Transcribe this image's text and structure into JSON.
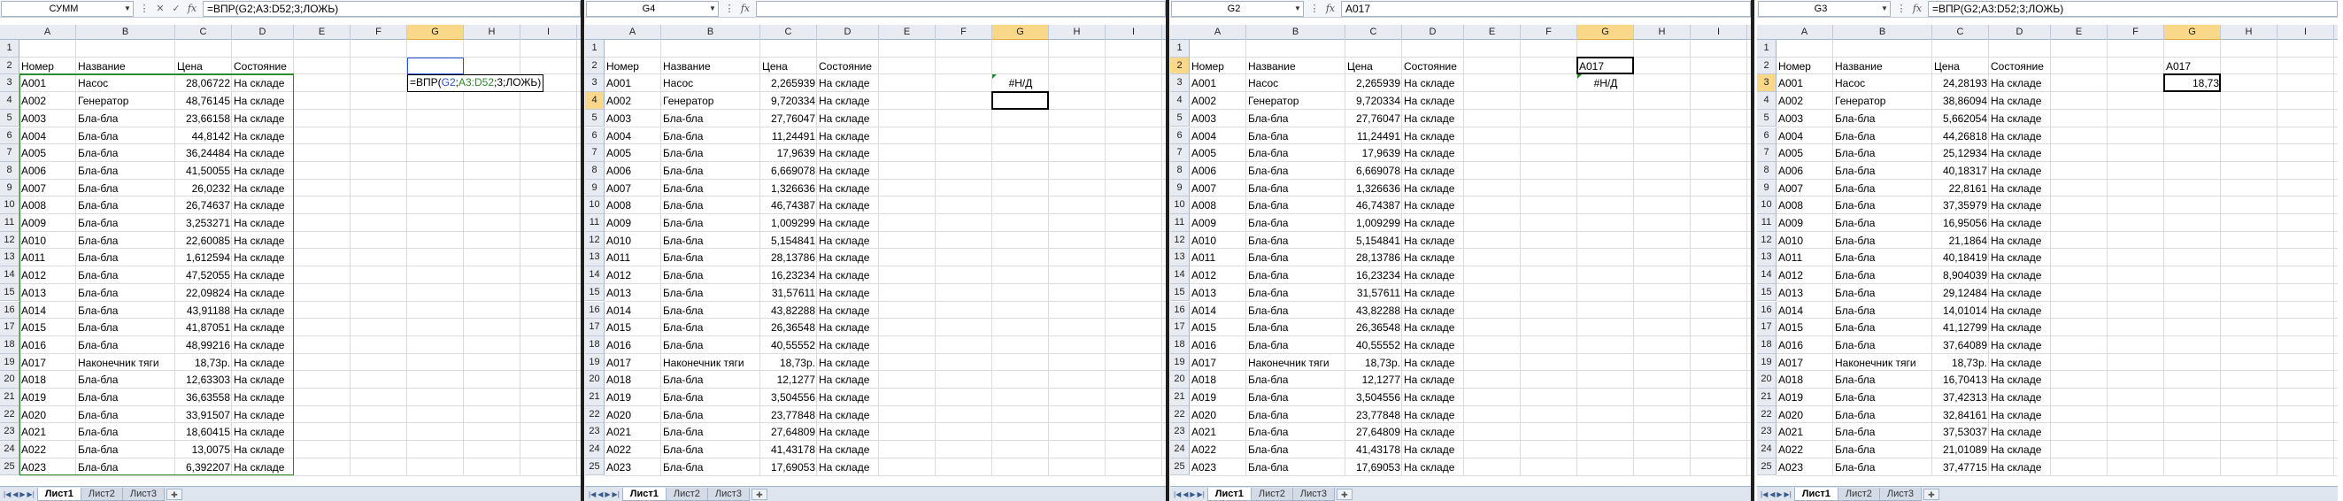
{
  "columns": [
    "A",
    "B",
    "C",
    "D",
    "E",
    "F",
    "G",
    "H",
    "I"
  ],
  "rows": [
    "1",
    "2",
    "3",
    "4",
    "5",
    "6",
    "7",
    "8",
    "9",
    "10",
    "11",
    "12",
    "13",
    "14",
    "15",
    "16",
    "17",
    "18",
    "19",
    "20",
    "21",
    "22",
    "23",
    "24",
    "25"
  ],
  "headers": {
    "A": "Номер",
    "B": "Название",
    "C": "Цена",
    "D": "Состояние"
  },
  "sheet_tabs": [
    "Лист1",
    "Лист2",
    "Лист3"
  ],
  "new_sheet_icon": "insert-sheet-icon",
  "fx_label": "fx",
  "panels": [
    {
      "namebox": "СУММ",
      "formula_parts": [
        {
          "t": "=ВПР(G2;A3:D52;3;ЛОЖЬ)",
          "c": ""
        }
      ],
      "selected_col": "G",
      "selected_row": "",
      "edit_formula_parts": [
        {
          "t": "=ВПР(",
          "c": ""
        },
        {
          "t": "G2",
          "c": "blue"
        },
        {
          "t": ";",
          "c": ""
        },
        {
          "t": "A3:D52",
          "c": "green"
        },
        {
          "t": ";3;ЛОЖЬ)",
          "c": ""
        }
      ],
      "g_cells": {},
      "ids": [
        "A001",
        "A002",
        "A003",
        "A004",
        "A005",
        "A006",
        "A007",
        "A008",
        "A009",
        "A010",
        "A011",
        "A012",
        "A013",
        "A014",
        "A015",
        "A016",
        "A017",
        "A018",
        "A019",
        "A020",
        "A021",
        "A022",
        "A023"
      ],
      "names": [
        "Насос",
        "Генератор",
        "Бла-бла",
        "Бла-бла",
        "Бла-бла",
        "Бла-бла",
        "Бла-бла",
        "Бла-бла",
        "Бла-бла",
        "Бла-бла",
        "Бла-бла",
        "Бла-бла",
        "Бла-бла",
        "Бла-бла",
        "Бла-бла",
        "Бла-бла",
        "Наконечник тяги",
        "Бла-бла",
        "Бла-бла",
        "Бла-бла",
        "Бла-бла",
        "Бла-бла",
        "Бла-бла"
      ],
      "prices": [
        "28,06722",
        "48,76145",
        "23,66158",
        "44,8142",
        "36,24484",
        "41,50055",
        "26,0232",
        "26,74637",
        "3,253271",
        "22,60085",
        "1,612594",
        "47,52055",
        "22,09824",
        "43,91188",
        "41,87051",
        "48,99216",
        "18,73р.",
        "12,63303",
        "36,63558",
        "33,91507",
        "18,60415",
        "13,0075",
        "6,392207"
      ],
      "statuses": [
        "На складе",
        "На складе",
        "На складе",
        "На складе",
        "На складе",
        "На складе",
        "На складе",
        "На складе",
        "На складе",
        "На складе",
        "На складе",
        "На складе",
        "На складе",
        "На складе",
        "На складе",
        "На складе",
        "На складе",
        "На складе",
        "На складе",
        "На складе",
        "На складе",
        "На складе",
        "На складе"
      ]
    },
    {
      "namebox": "G4",
      "formula_parts": [],
      "selected_col": "G",
      "selected_row": "4",
      "g_cells": {
        "3": "#Н/Д"
      },
      "ids": [
        "A001",
        "A002",
        "A003",
        "A004",
        "A005",
        "A006",
        "A007",
        "A008",
        "A009",
        "A010",
        "A011",
        "A012",
        "A013",
        "A014",
        "A015",
        "A016",
        "A017",
        "A018",
        "A019",
        "A020",
        "A021",
        "A022",
        "A023"
      ],
      "names": [
        "Насос",
        "Генератор",
        "Бла-бла",
        "Бла-бла",
        "Бла-бла",
        "Бла-бла",
        "Бла-бла",
        "Бла-бла",
        "Бла-бла",
        "Бла-бла",
        "Бла-бла",
        "Бла-бла",
        "Бла-бла",
        "Бла-бла",
        "Бла-бла",
        "Бла-бла",
        "Наконечник тяги",
        "Бла-бла",
        "Бла-бла",
        "Бла-бла",
        "Бла-бла",
        "Бла-бла",
        "Бла-бла"
      ],
      "prices": [
        "2,265939",
        "9,720334",
        "27,76047",
        "11,24491",
        "17,9639",
        "6,669078",
        "1,326636",
        "46,74387",
        "1,009299",
        "5,154841",
        "28,13786",
        "16,23234",
        "31,57611",
        "43,82288",
        "26,36548",
        "40,55552",
        "18,73р.",
        "12,1277",
        "3,504556",
        "23,77848",
        "27,64809",
        "41,43178",
        "17,69053"
      ],
      "statuses": [
        "На складе",
        "На складе",
        "На складе",
        "На складе",
        "На складе",
        "На складе",
        "На складе",
        "На складе",
        "На складе",
        "На складе",
        "На складе",
        "На складе",
        "На складе",
        "На складе",
        "На складе",
        "На складе",
        "На складе",
        "На складе",
        "На складе",
        "На складе",
        "На складе",
        "На складе",
        "На складе"
      ]
    },
    {
      "namebox": "G2",
      "formula_parts": [
        {
          "t": "A017",
          "c": ""
        }
      ],
      "selected_col": "G",
      "selected_row": "2",
      "g_cells": {
        "2": "A017",
        "3": "#Н/Д"
      },
      "ids": [
        "A001",
        "A002",
        "A003",
        "A004",
        "A005",
        "A006",
        "A007",
        "A008",
        "A009",
        "A010",
        "A011",
        "A012",
        "A013",
        "A014",
        "A015",
        "A016",
        "A017",
        "A018",
        "A019",
        "A020",
        "A021",
        "A022",
        "A023"
      ],
      "names": [
        "Насос",
        "Генератор",
        "Бла-бла",
        "Бла-бла",
        "Бла-бла",
        "Бла-бла",
        "Бла-бла",
        "Бла-бла",
        "Бла-бла",
        "Бла-бла",
        "Бла-бла",
        "Бла-бла",
        "Бла-бла",
        "Бла-бла",
        "Бла-бла",
        "Бла-бла",
        "Наконечник тяги",
        "Бла-бла",
        "Бла-бла",
        "Бла-бла",
        "Бла-бла",
        "Бла-бла",
        "Бла-бла"
      ],
      "prices": [
        "2,265939",
        "9,720334",
        "27,76047",
        "11,24491",
        "17,9639",
        "6,669078",
        "1,326636",
        "46,74387",
        "1,009299",
        "5,154841",
        "28,13786",
        "16,23234",
        "31,57611",
        "43,82288",
        "26,36548",
        "40,55552",
        "18,73р.",
        "12,1277",
        "3,504556",
        "23,77848",
        "27,64809",
        "41,43178",
        "17,69053"
      ],
      "statuses": [
        "На складе",
        "На складе",
        "На складе",
        "На складе",
        "На складе",
        "На складе",
        "На складе",
        "На складе",
        "На складе",
        "На складе",
        "На складе",
        "На складе",
        "На складе",
        "На складе",
        "На складе",
        "На складе",
        "На складе",
        "На складе",
        "На складе",
        "На складе",
        "На складе",
        "На складе",
        "На складе"
      ]
    },
    {
      "namebox": "G3",
      "formula_parts": [
        {
          "t": "=ВПР(G2;A3:D52;3;ЛОЖЬ)",
          "c": ""
        }
      ],
      "selected_col": "G",
      "selected_row": "3",
      "g_cells": {
        "2": "A017",
        "3": "18,73"
      },
      "ids": [
        "A001",
        "A002",
        "A003",
        "A004",
        "A005",
        "A006",
        "A007",
        "A008",
        "A009",
        "A010",
        "A011",
        "A012",
        "A013",
        "A014",
        "A015",
        "A016",
        "A017",
        "A018",
        "A019",
        "A020",
        "A021",
        "A022",
        "A023"
      ],
      "names": [
        "Насос",
        "Генератор",
        "Бла-бла",
        "Бла-бла",
        "Бла-бла",
        "Бла-бла",
        "Бла-бла",
        "Бла-бла",
        "Бла-бла",
        "Бла-бла",
        "Бла-бла",
        "Бла-бла",
        "Бла-бла",
        "Бла-бла",
        "Бла-бла",
        "Бла-бла",
        "Наконечник тяги",
        "Бла-бла",
        "Бла-бла",
        "Бла-бла",
        "Бла-бла",
        "Бла-бла",
        "Бла-бла"
      ],
      "prices": [
        "24,28193",
        "38,86094",
        "5,662054",
        "44,26818",
        "25,12934",
        "40,18317",
        "22,8161",
        "37,35979",
        "16,95056",
        "21,1864",
        "40,18419",
        "8,904039",
        "29,12484",
        "14,01014",
        "41,12799",
        "37,64089",
        "18,73р.",
        "16,70413",
        "37,42313",
        "32,84161",
        "37,53037",
        "21,01089",
        "37,47715"
      ],
      "statuses": [
        "На складе",
        "На складе",
        "На складе",
        "На складе",
        "На складе",
        "На складе",
        "На складе",
        "На складе",
        "На складе",
        "На складе",
        "На складе",
        "На складе",
        "На складе",
        "На складе",
        "На складе",
        "На складе",
        "На складе",
        "На складе",
        "На складе",
        "На складе",
        "На складе",
        "На складе",
        "На складе"
      ]
    }
  ]
}
